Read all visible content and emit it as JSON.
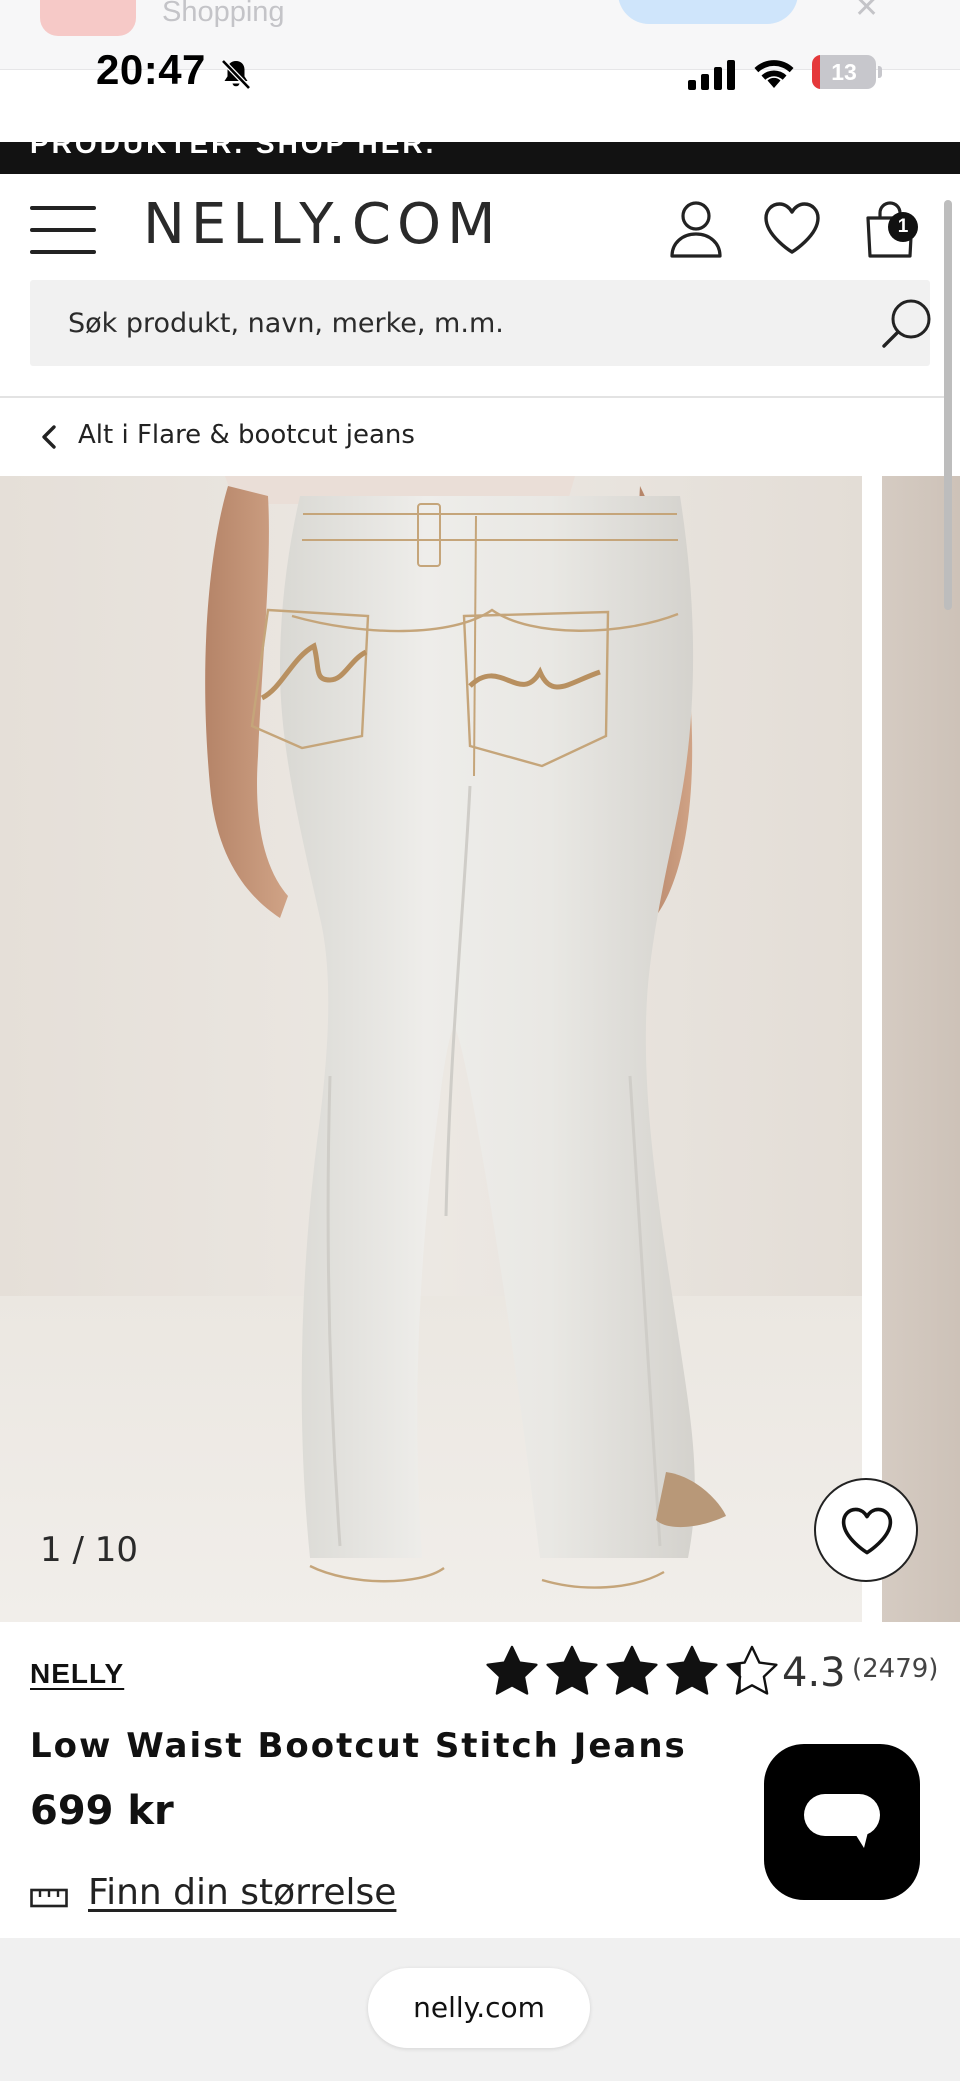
{
  "peek": {
    "app_title": "Shopping"
  },
  "status_bar": {
    "time": "20:47",
    "battery_level": "13",
    "battery_fraction": 0.13,
    "battery_color": "#e5383b"
  },
  "promo_banner": {
    "text": "PRODUKTER. SHOP HER."
  },
  "header": {
    "logo": "NELLY.COM",
    "cart_count": "1",
    "search_placeholder": "Søk produkt, navn, merke, m.m."
  },
  "breadcrumb": {
    "label": "Alt i Flare & bootcut jeans"
  },
  "gallery": {
    "counter": "1 / 10"
  },
  "product": {
    "brand": "NELLY",
    "rating_value": "4.3",
    "rating_numeric": 4.3,
    "rating_max": 5,
    "review_count": "(2479)",
    "name": "Low Waist Bootcut Stitch Jeans",
    "price": "699 kr",
    "size_link": "Finn din størrelse"
  },
  "browser": {
    "url": "nelly.com"
  },
  "icons": [
    "bell-slash-icon",
    "signal-icon",
    "wifi-icon",
    "battery-icon",
    "menu-icon",
    "user-icon",
    "heart-icon",
    "bag-icon",
    "search-icon",
    "chevron-left-icon",
    "star-icon",
    "ruler-icon",
    "chat-icon"
  ]
}
